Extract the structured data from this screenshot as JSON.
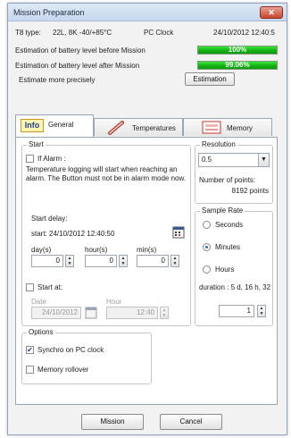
{
  "window": {
    "title": "Mission Preparation",
    "close": "✕"
  },
  "device": {
    "type_label": "T8 type:",
    "type_value": "22L, 8K -40/+85°C",
    "clock_label": "PC Clock",
    "clock_value": "24/10/2012 12:40:5"
  },
  "battery": {
    "before_label": "Estimation of battery level before Mission",
    "before_value": "100%",
    "before_level": 100,
    "after_label": "Estimation of battery level after Mission",
    "after_value": "99.06%",
    "after_level": 99.06,
    "precise_label": "Estimate more precisely",
    "estimation_button": "Estimation"
  },
  "tabs": [
    {
      "label": "General",
      "icon": "info-icon"
    },
    {
      "label": "Temperatures",
      "icon": "thermometer-icon"
    },
    {
      "label": "Memory",
      "icon": "memory-icon"
    }
  ],
  "start": {
    "title": "Start",
    "if_alarm_label": "If Alarm :",
    "alarm_note": "Temperature logging will start when reaching an alarm. The Button must not be in alarm mode now.",
    "start_delay_label": "Start delay:",
    "start_value": "start: 24/10/2012 12:40:50",
    "days_label": "day(s)",
    "days_value": "0",
    "hours_label": "hour(s)",
    "hours_value": "0",
    "mins_label": "min(s)",
    "mins_value": "0",
    "start_at_label": "Start at:",
    "date_label": "Date",
    "date_value": "24/10/2012",
    "hour_label": "Hour",
    "hour_value": "12:40"
  },
  "resolution": {
    "title": "Resolution",
    "value": "0.5",
    "points_label": "Number of points:",
    "points_value": "8192 points"
  },
  "sample_rate": {
    "title": "Sample Rate",
    "options": [
      "Seconds",
      "Minutes",
      "Hours"
    ],
    "selected": "Minutes",
    "duration": "duration : 5 d, 16 h, 32",
    "value": "1"
  },
  "options": {
    "title": "Options",
    "synchro_label": "Synchro on PC clock",
    "synchro_checked": true,
    "rollover_label": "Memory rollover",
    "rollover_checked": false
  },
  "footer": {
    "mission_button": "Mission",
    "cancel_button": "Cancel"
  }
}
